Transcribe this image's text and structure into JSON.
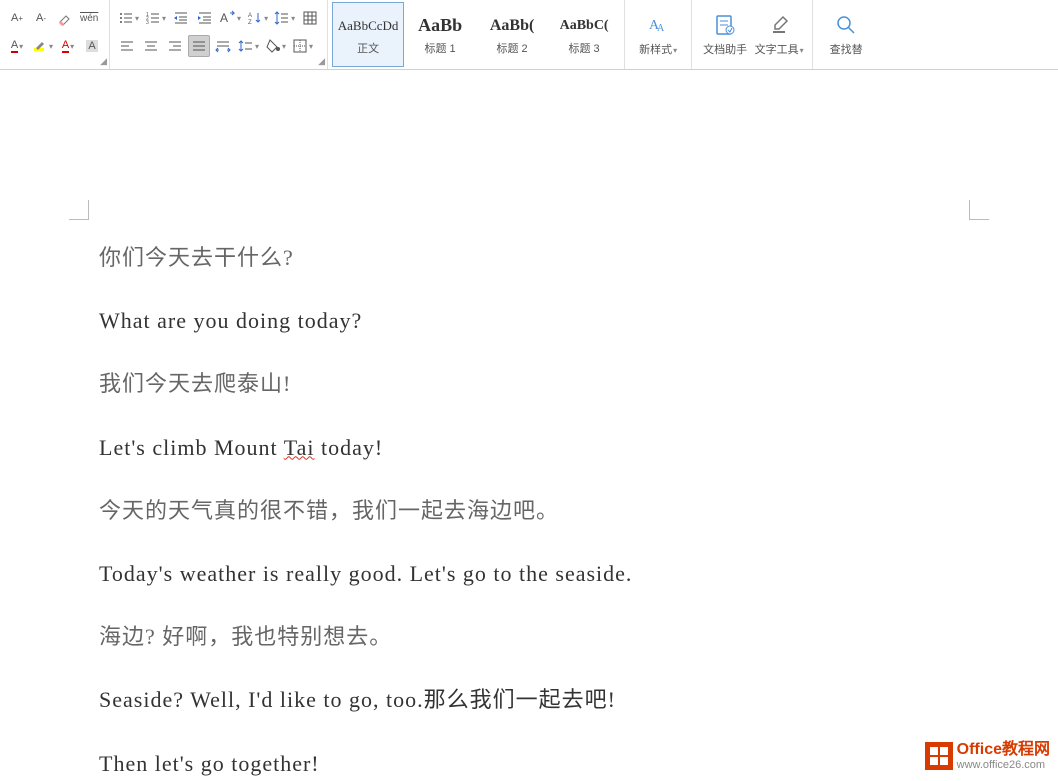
{
  "styles": {
    "normal_preview": "AaBbCcDd",
    "normal_label": "正文",
    "h1_preview": "AaBb",
    "h1_label": "标题 1",
    "h2_preview": "AaBb(",
    "h2_label": "标题 2",
    "h3_preview": "AaBbC(",
    "h3_label": "标题 3"
  },
  "buttons": {
    "new_style": "新样式",
    "doc_assistant": "文档助手",
    "text_tools": "文字工具",
    "find_replace": "查找替"
  },
  "document": {
    "paragraphs": [
      {
        "cls": "cn",
        "text": "你们今天去干什么?"
      },
      {
        "cls": "en",
        "text": "What are you doing today?"
      },
      {
        "cls": "cn",
        "text": "我们今天去爬泰山!"
      },
      {
        "cls": "en",
        "text_pre": "Let's climb Mount ",
        "squiggle": "Tai",
        "text_post": " today!"
      },
      {
        "cls": "cn",
        "text": "今天的天气真的很不错，我们一起去海边吧。"
      },
      {
        "cls": "en",
        "text": "Today's weather is really good. Let's go to the seaside."
      },
      {
        "cls": "cn",
        "text": "海边? 好啊，我也特别想去。"
      },
      {
        "cls": "en",
        "text": "Seaside? Well, I'd like to go, too.那么我们一起去吧!"
      },
      {
        "cls": "en",
        "text": "Then let's go together!"
      }
    ]
  },
  "watermark": {
    "title": "Office教程网",
    "url": "www.office26.com"
  }
}
